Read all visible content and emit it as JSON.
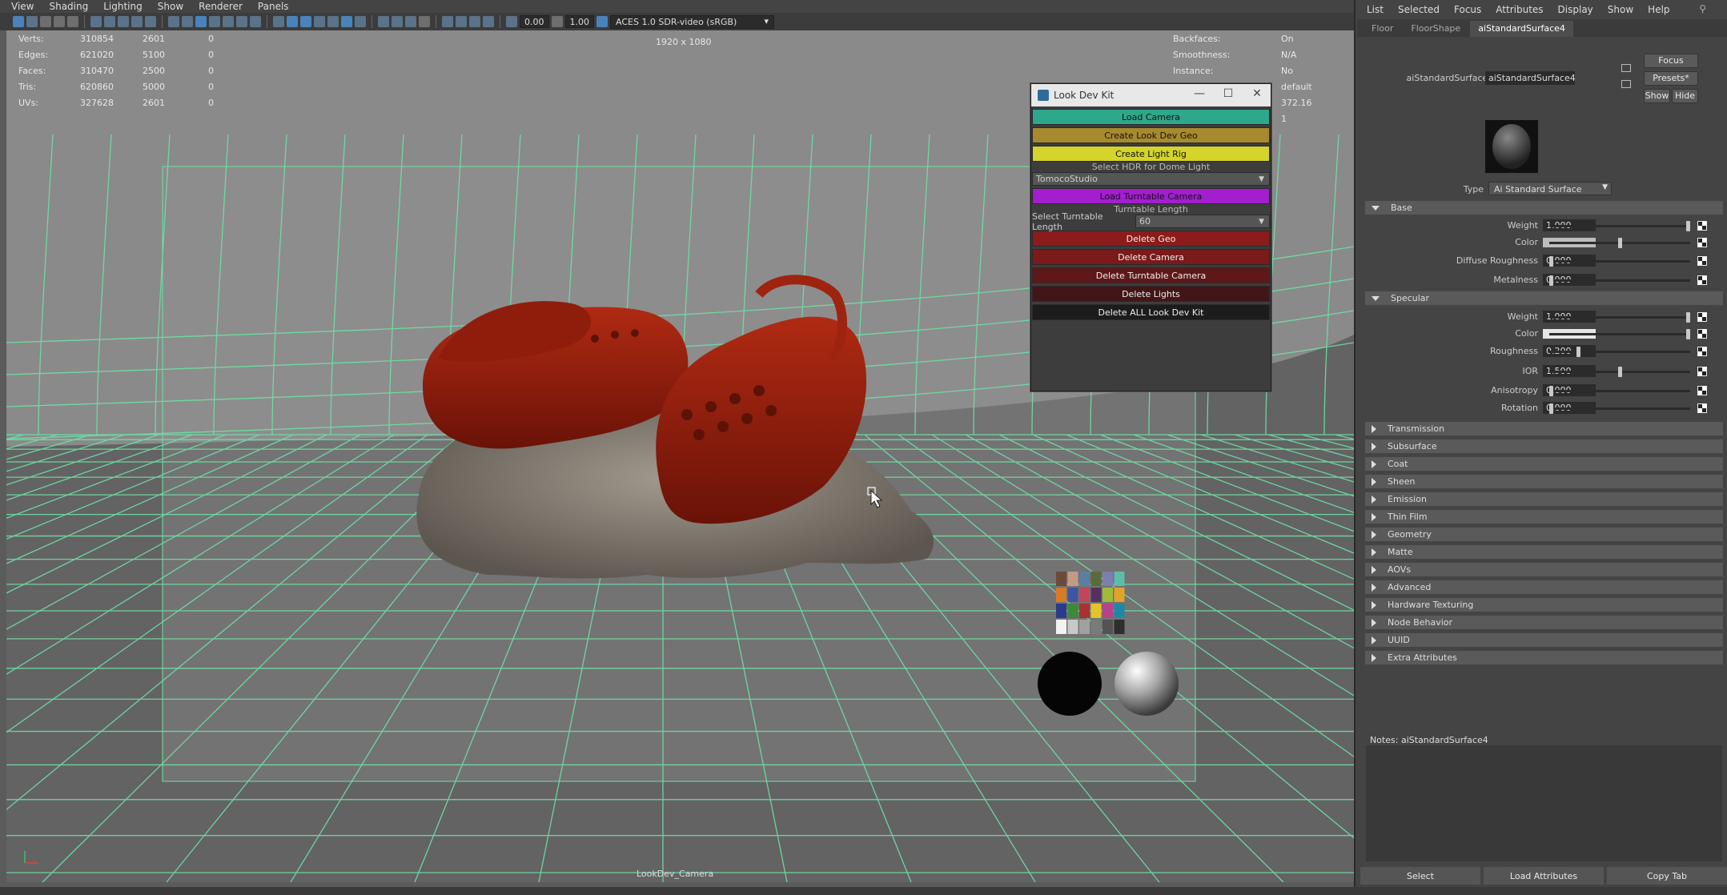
{
  "viewport": {
    "menu": [
      "View",
      "Shading",
      "Lighting",
      "Show",
      "Renderer",
      "Panels"
    ],
    "toolbar": {
      "exposure": "0.00",
      "gamma": "1.00",
      "color_transform": "ACES 1.0 SDR-video (sRGB)"
    },
    "hud_stats": [
      {
        "k": "Verts:",
        "v1": "310854",
        "v2": "2601",
        "v3": "0"
      },
      {
        "k": "Edges:",
        "v1": "621020",
        "v2": "5100",
        "v3": "0"
      },
      {
        "k": "Faces:",
        "v1": "310470",
        "v2": "2500",
        "v3": "0"
      },
      {
        "k": "Tris:",
        "v1": "620860",
        "v2": "5000",
        "v3": "0"
      },
      {
        "k": "UVs:",
        "v1": "327628",
        "v2": "2601",
        "v3": "0"
      }
    ],
    "hud_resolution": "1920 x 1080",
    "hud_right": [
      {
        "k": "Backfaces:",
        "v": "On"
      },
      {
        "k": "Smoothness:",
        "v": "N/A"
      },
      {
        "k": "Instance:",
        "v": "No"
      },
      {
        "k": "",
        "v": "default"
      },
      {
        "k": "",
        "v": "372.16"
      },
      {
        "k": "",
        "v": "1"
      }
    ],
    "camera_name": "LookDev_Camera"
  },
  "lookdevkit": {
    "title": "Look Dev Kit",
    "load_camera": "Load Camera",
    "create_geo": "Create Look Dev Geo",
    "create_light_rig": "Create Light Rig",
    "hdr_label": "Select HDR for Dome Light",
    "hdr_value": "TomocoStudio",
    "load_turntable": "Load Turntable Camera",
    "turntable_label": "Turntable Length",
    "turntable_select_label": "Select Turntable Length",
    "turntable_value": "60",
    "delete_geo": "Delete Geo",
    "delete_camera": "Delete Camera",
    "delete_turntable": "Delete Turntable Camera",
    "delete_lights": "Delete Lights",
    "delete_all": "Delete ALL Look Dev Kit",
    "colors": {
      "load_camera": "#2ea88a",
      "create_geo": "#a88a2e",
      "create_light_rig": "#d4d42a",
      "load_turntable": "#a21ecf",
      "delete_geo": "#8c1c1c",
      "delete_camera": "#7a1a1a",
      "delete_turntable": "#5e1818",
      "delete_lights": "#421616",
      "delete_all": "#1c1c1c"
    }
  },
  "attribute_editor": {
    "menu": [
      "List",
      "Selected",
      "Focus",
      "Attributes",
      "Display",
      "Show",
      "Help"
    ],
    "tabs": [
      "Floor",
      "FloorShape",
      "aiStandardSurface4"
    ],
    "node_label": "aiStandardSurface:",
    "node_name": "aiStandardSurface4",
    "focus": "Focus",
    "presets": "Presets*",
    "show": "Show",
    "hide": "Hide",
    "type_label": "Type",
    "type_value": "Ai Standard Surface",
    "base": {
      "title": "Base",
      "weight_label": "Weight",
      "weight": "1.000",
      "color_label": "Color",
      "diffuse_roughness_label": "Diffuse Roughness",
      "diffuse_roughness": "0.000",
      "metalness_label": "Metalness",
      "metalness": "0.000"
    },
    "specular": {
      "title": "Specular",
      "weight_label": "Weight",
      "weight": "1.000",
      "color_label": "Color",
      "roughness_label": "Roughness",
      "roughness": "0.200",
      "ior_label": "IOR",
      "ior": "1.500",
      "anisotropy_label": "Anisotropy",
      "anisotropy": "0.000",
      "rotation_label": "Rotation",
      "rotation": "0.000"
    },
    "collapsed_sections": [
      "Transmission",
      "Subsurface",
      "Coat",
      "Sheen",
      "Emission",
      "Thin Film",
      "Geometry",
      "Matte",
      "AOVs",
      "Advanced",
      "Hardware Texturing",
      "Node Behavior",
      "UUID",
      "Extra Attributes"
    ],
    "notes_label": "Notes:  aiStandardSurface4",
    "bottom_buttons": [
      "Select",
      "Load Attributes",
      "Copy Tab"
    ]
  }
}
